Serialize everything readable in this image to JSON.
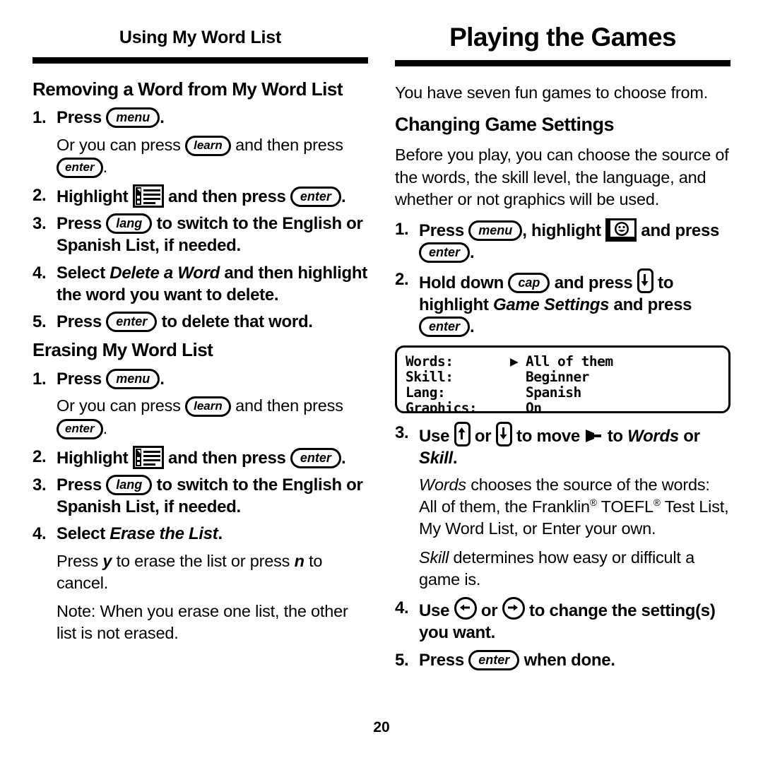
{
  "page": {
    "folio": "20"
  },
  "left_column": {
    "running_head": "Using My Word List",
    "section1": {
      "heading": "Removing a Word from My Word List",
      "steps": {
        "s1_num": "1.",
        "s1_pre": "Press",
        "s1_key": "menu",
        "s1_post": ".",
        "s1_note_pre": "Or you can press",
        "s1_note_key": "learn",
        "s1_note_mid": "and then press",
        "s1_note_key2": "enter",
        "s1_note_post": ".",
        "s2_num": "2.",
        "s2_pre": "Highlight",
        "s2_icon": "word-list-icon",
        "s2_mid": "and then press",
        "s2_key": "enter",
        "s2_post": ".",
        "s3_num": "3.",
        "s3_pre": "Press",
        "s3_key": "lang",
        "s3_post": "to switch to the English or Spanish List, if needed.",
        "s4_num": "4.",
        "s4_pre": "Select",
        "s4_italic": "Delete a Word",
        "s4_post": "and then highlight the word you want to delete.",
        "s5_num": "5.",
        "s5_pre": "Press",
        "s5_key": "enter",
        "s5_post": "to delete that word."
      }
    },
    "section2": {
      "heading": "Erasing My Word List",
      "steps": {
        "s1_num": "1.",
        "s1_pre": "Press",
        "s1_key": "menu",
        "s1_post": ".",
        "s1_note_pre": "Or you can press",
        "s1_note_key": "learn",
        "s1_note_mid": "and then press",
        "s1_note_key2": "enter",
        "s1_note_post": ".",
        "s2_num": "2.",
        "s2_pre": "Highlight",
        "s2_icon": "word-list-icon",
        "s2_mid": "and then press",
        "s2_key": "enter",
        "s2_post": ".",
        "s3_num": "3.",
        "s3_pre": "Press",
        "s3_key": "lang",
        "s3_post": "to switch to the English or Spanish List, if needed.",
        "s4_num": "4.",
        "s4_pre": "Select",
        "s4_italic": "Erase the List",
        "s4_post": ".",
        "note1_pre": "Press",
        "note1_key": "y",
        "note1_mid": "to erase the list or press",
        "note1_key2": "n",
        "note1_post": "to cancel.",
        "note2": "Note: When you erase one list, the other list is not erased."
      }
    }
  },
  "right_column": {
    "running_head": "Playing the Games",
    "intro": "You have seven fun games to choose from.",
    "section1": {
      "heading": "Changing Game Settings",
      "lede": "Before you play, you can choose the source of the words, the skill level, the language, and whether or not graphics will be used.",
      "steps": {
        "s1_num": "1.",
        "s1_pre": "Press",
        "s1_key": "menu",
        "s1_mid": ", highlight",
        "s1_icon": "games-smiley-icon",
        "s1_mid2": "and press",
        "s1_key2": "enter",
        "s1_post": ".",
        "s2_num": "2.",
        "s2_pre": "Hold down",
        "s2_key": "cap",
        "s2_mid": "and press",
        "s2_key2": "down-arrow-key",
        "s2_mid2": "to highlight",
        "s2_italic": "Game Settings",
        "s2_mid3": "and press",
        "s2_key3": "enter",
        "s2_post": ".",
        "s3_num": "3.",
        "s3_pre": "Use",
        "s3_key": "up-arrow-key",
        "s3_mid": "or",
        "s3_key2": "down-arrow-key",
        "s3_mid2": "to move",
        "s3_pointer": "pointer-glyph",
        "s3_mid3": "to",
        "s3_italic": "Words",
        "s3_mid4": "or",
        "s3_italic2": "Skill",
        "s3_post": ".",
        "s3_note1_italic": "Words",
        "s3_note1_a": "chooses the source of the words: All of them, the Franklin",
        "s3_note1_reg1": "®",
        "s3_note1_b": "TOEFL",
        "s3_note1_reg2": "®",
        "s3_note1_c": "Test List, My Word List, or Enter your own.",
        "s3_note2_italic": "Skill",
        "s3_note2": "determines how easy or difficult a game is.",
        "s4_num": "4.",
        "s4_pre": "Use",
        "s4_key": "left-arrow-key",
        "s4_mid": "or",
        "s4_key2": "right-arrow-key",
        "s4_post": "to change the setting(s) you want.",
        "s5_num": "5.",
        "s5_pre": "Press",
        "s5_key": "enter",
        "s5_post": "when done."
      },
      "lcd_screen": {
        "rows": [
          {
            "label": "Words:",
            "marker": "▶",
            "value": "All of them"
          },
          {
            "label": "Skill:",
            "marker": "",
            "value": "Beginner"
          },
          {
            "label": "Lang:",
            "marker": "",
            "value": "Spanish"
          },
          {
            "label": "Graphics:",
            "marker": "",
            "value": "On"
          }
        ]
      }
    }
  }
}
